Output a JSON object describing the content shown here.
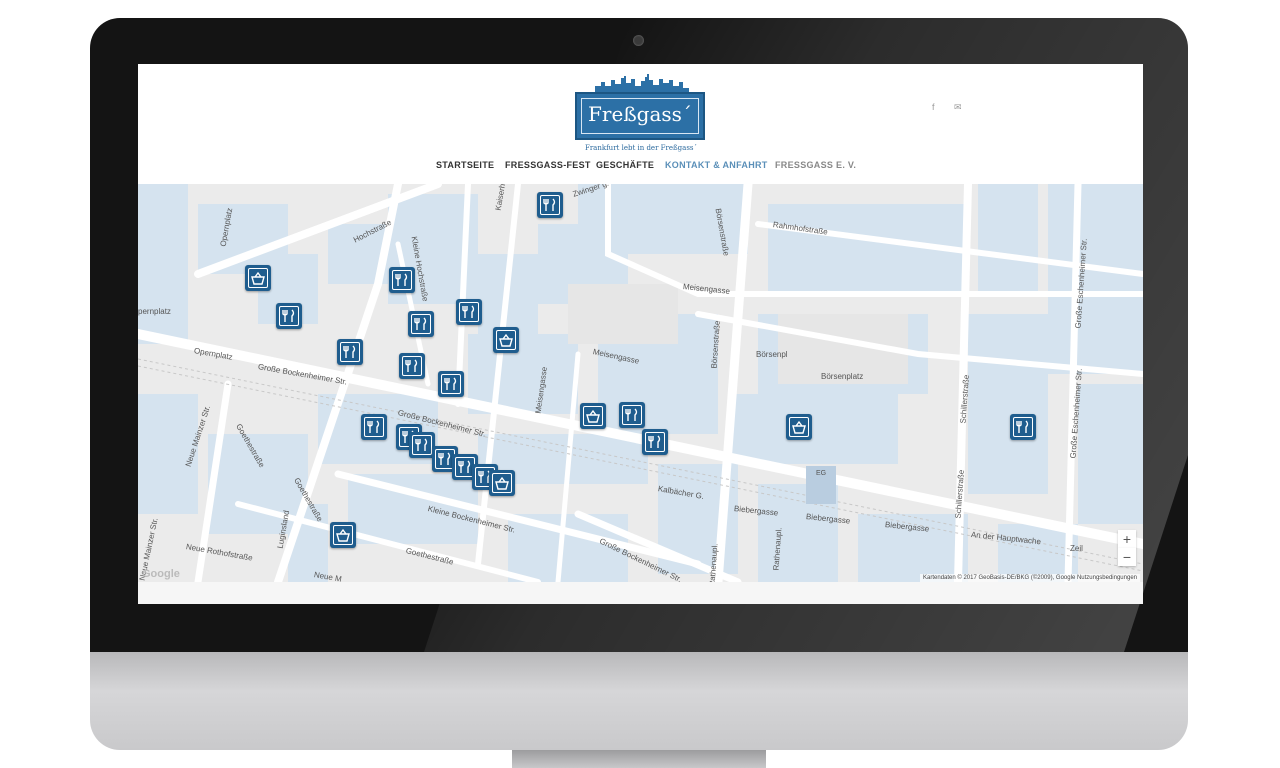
{
  "site": {
    "logo_title": "Freßgass´",
    "logo_tagline": "Frankfurt lebt in der Freßgass´"
  },
  "social": {
    "facebook_icon": "f",
    "mail_icon": "✉"
  },
  "nav": {
    "items": [
      {
        "label": "STARTSEITE",
        "active": false
      },
      {
        "label": "FRESSGASS-FEST",
        "active": false
      },
      {
        "label": "GESCHÄFTE",
        "active": false
      },
      {
        "label": "KONTAKT & ANFAHRT",
        "active": true
      },
      {
        "label": "FRESSGASS E. V.",
        "active": false
      }
    ],
    "active_color": "#5a8fb8"
  },
  "map": {
    "streets": [
      "Zwinger g.",
      "Hochstraße",
      "Kleine Hochstraße",
      "Kaiserhofstraße",
      "Rahmhofstraße",
      "Opernplatz",
      "pernplatz",
      "Opernplatz",
      "Große Bockenheimer Str.",
      "Große Bockenheimer Str.",
      "Meisengasse",
      "Meisengasse",
      "Meisengasse",
      "Börsenstraße",
      "Börsenstraße",
      "Börsenpl",
      "Börsenplatz",
      "Goethestraße",
      "Goethestraße",
      "Neue Mainzer Str.",
      "Neue Mainzer Str.",
      "Goethestraße",
      "Luginsland",
      "Kleine Bockenheimer Str.",
      "Große Bockenheimer Str.",
      "Kalbächer G.",
      "Biebergasse",
      "Biebergasse",
      "Biebergasse",
      "An der Hauptwache",
      "Neue Rothofstraße",
      "Rathenaupl.",
      "Rathenaupl.",
      "Schillerstraße",
      "Schillerstraße",
      "Große Eschenheimer Str.",
      "Große Eschenheimer Str.",
      "Zeil",
      "Neue M",
      "EG"
    ],
    "markers": [
      {
        "type": "restaurant-icon"
      },
      {
        "type": "shopping-basket-icon"
      },
      {
        "type": "restaurant-icon"
      },
      {
        "type": "restaurant-icon"
      },
      {
        "type": "restaurant-icon"
      },
      {
        "type": "restaurant-icon"
      },
      {
        "type": "shopping-basket-icon"
      },
      {
        "type": "restaurant-icon"
      },
      {
        "type": "restaurant-icon"
      },
      {
        "type": "restaurant-icon"
      },
      {
        "type": "restaurant-icon"
      },
      {
        "type": "shopping-basket-icon"
      },
      {
        "type": "restaurant-icon"
      },
      {
        "type": "restaurant-icon"
      },
      {
        "type": "restaurant-icon"
      },
      {
        "type": "restaurant-icon"
      },
      {
        "type": "restaurant-icon"
      },
      {
        "type": "restaurant-icon"
      },
      {
        "type": "restaurant-icon"
      },
      {
        "type": "shopping-basket-icon"
      },
      {
        "type": "shopping-basket-icon"
      },
      {
        "type": "restaurant-icon"
      },
      {
        "type": "restaurant-icon"
      },
      {
        "type": "shopping-basket-icon"
      },
      {
        "type": "restaurant-icon"
      }
    ],
    "zoom_in": "+",
    "zoom_out": "−",
    "attribution": "Kartendaten © 2017 GeoBasis-DE/BKG (©2009), Google   Nutzungsbedingungen",
    "google_logo": "Google",
    "marker_color": "#1f5d8e",
    "block_color": "#d5e3ef",
    "road_color": "#ffffff"
  }
}
